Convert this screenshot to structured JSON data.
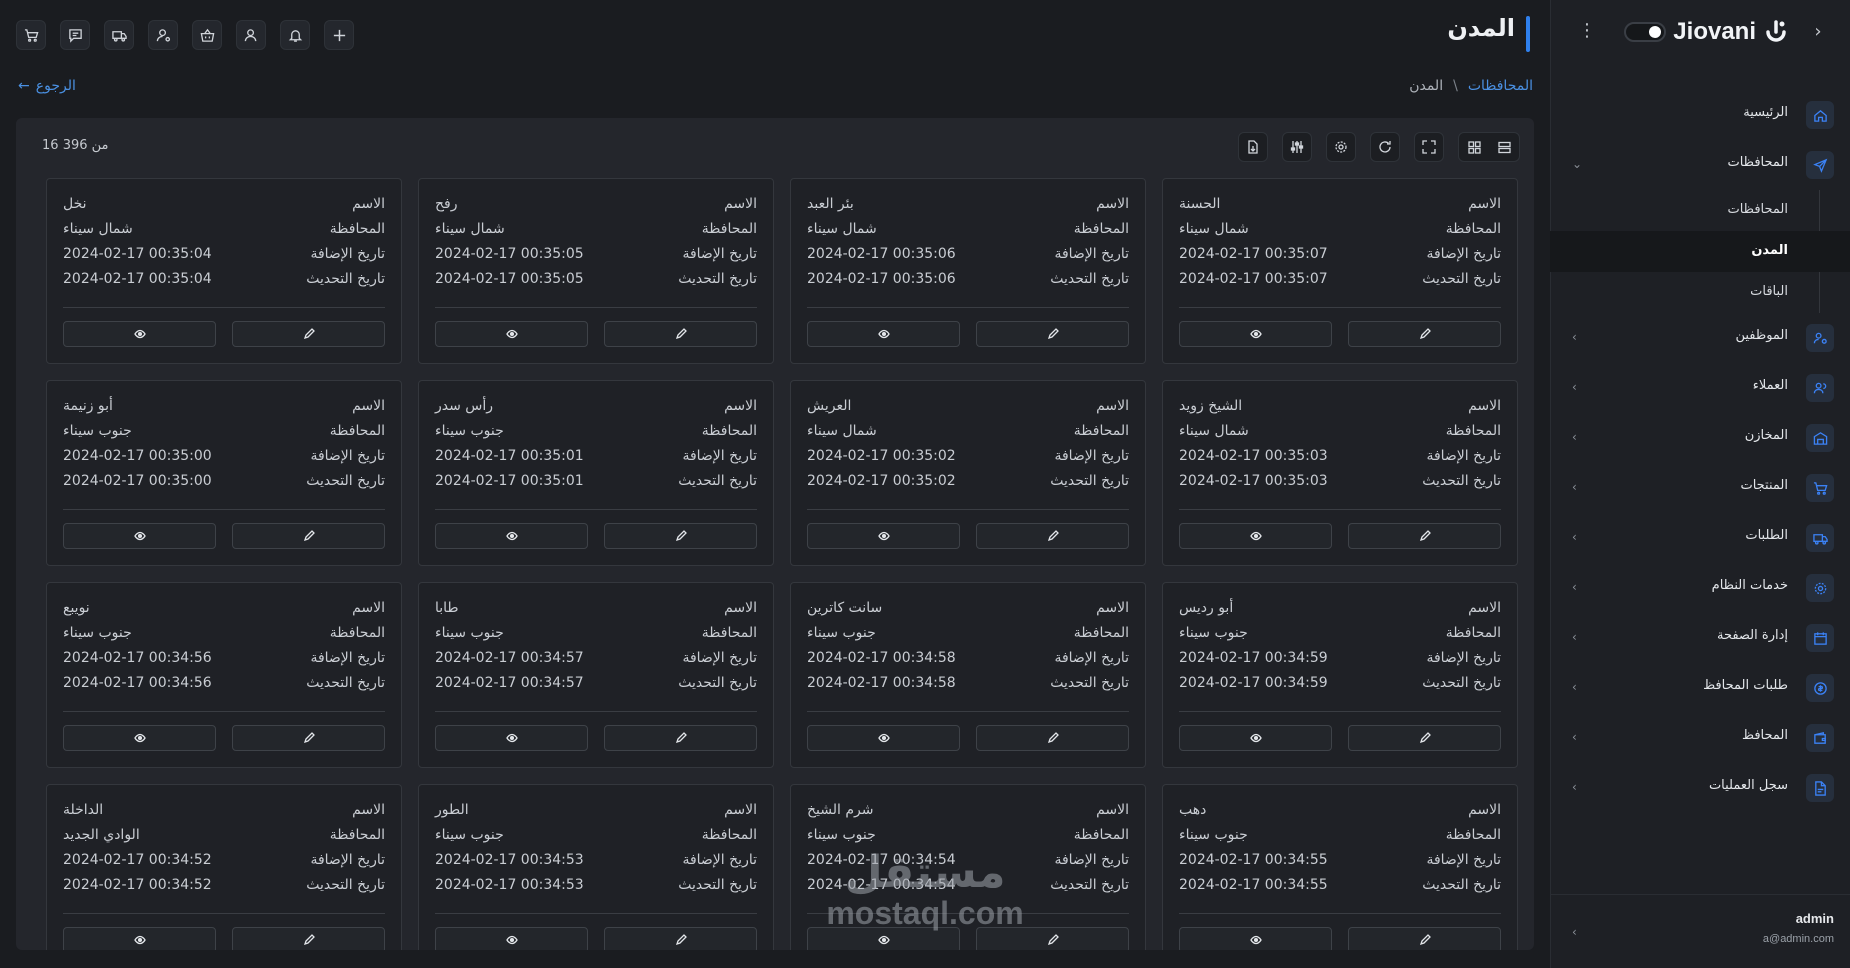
{
  "app": {
    "brand": "Jiovani"
  },
  "header": {
    "title": "المدن"
  },
  "breadcrumb": {
    "root": "المحافظات",
    "separator": "\\",
    "current": "المدن"
  },
  "back": {
    "label": "الرجوع"
  },
  "pager": {
    "count_text": "16 من 396"
  },
  "sidebar": {
    "items": [
      {
        "label": "الرئيسية",
        "icon": "home-icon"
      },
      {
        "label": "المحافظات",
        "icon": "send-icon",
        "expanded": true
      },
      {
        "label": "الموظفين",
        "icon": "users-cog-icon"
      },
      {
        "label": "العملاء",
        "icon": "users-icon"
      },
      {
        "label": "المخازن",
        "icon": "warehouse-icon"
      },
      {
        "label": "المنتجات",
        "icon": "cart-icon"
      },
      {
        "label": "الطلبات",
        "icon": "truck-icon"
      },
      {
        "label": "خدمات النظام",
        "icon": "gear-icon"
      },
      {
        "label": "إدارة الصفحة",
        "icon": "calendar-icon"
      },
      {
        "label": "طلبات المحافظ",
        "icon": "coin-icon"
      },
      {
        "label": "المحافظ",
        "icon": "wallet-icon"
      },
      {
        "label": "سجل العمليات",
        "icon": "file-icon"
      }
    ],
    "sub_items": [
      {
        "label": "المحافظات"
      },
      {
        "label": "المدن",
        "active": true
      },
      {
        "label": "الباقات"
      }
    ],
    "user": {
      "name": "admin",
      "email": "a@admin.com"
    }
  },
  "card_labels": {
    "name": "الاسم",
    "governorate": "المحافظة",
    "created": "تاريخ الإضافة",
    "updated": "تاريخ التحديث"
  },
  "cards": [
    {
      "name": "الحسنة",
      "governorate": "شمال سيناء",
      "created": "2024-02-17 00:35:07",
      "updated": "2024-02-17 00:35:07"
    },
    {
      "name": "بئر العبد",
      "governorate": "شمال سيناء",
      "created": "2024-02-17 00:35:06",
      "updated": "2024-02-17 00:35:06"
    },
    {
      "name": "رفح",
      "governorate": "شمال سيناء",
      "created": "2024-02-17 00:35:05",
      "updated": "2024-02-17 00:35:05"
    },
    {
      "name": "نخل",
      "governorate": "شمال سيناء",
      "created": "2024-02-17 00:35:04",
      "updated": "2024-02-17 00:35:04"
    },
    {
      "name": "الشيخ زويد",
      "governorate": "شمال سيناء",
      "created": "2024-02-17 00:35:03",
      "updated": "2024-02-17 00:35:03"
    },
    {
      "name": "العريش",
      "governorate": "شمال سيناء",
      "created": "2024-02-17 00:35:02",
      "updated": "2024-02-17 00:35:02"
    },
    {
      "name": "رأس سدر",
      "governorate": "جنوب سيناء",
      "created": "2024-02-17 00:35:01",
      "updated": "2024-02-17 00:35:01"
    },
    {
      "name": "أبو زنيمة",
      "governorate": "جنوب سيناء",
      "created": "2024-02-17 00:35:00",
      "updated": "2024-02-17 00:35:00"
    },
    {
      "name": "أبو رديس",
      "governorate": "جنوب سيناء",
      "created": "2024-02-17 00:34:59",
      "updated": "2024-02-17 00:34:59"
    },
    {
      "name": "سانت كاترين",
      "governorate": "جنوب سيناء",
      "created": "2024-02-17 00:34:58",
      "updated": "2024-02-17 00:34:58"
    },
    {
      "name": "طابا",
      "governorate": "جنوب سيناء",
      "created": "2024-02-17 00:34:57",
      "updated": "2024-02-17 00:34:57"
    },
    {
      "name": "نويبع",
      "governorate": "جنوب سيناء",
      "created": "2024-02-17 00:34:56",
      "updated": "2024-02-17 00:34:56"
    },
    {
      "name": "دهب",
      "governorate": "جنوب سيناء",
      "created": "2024-02-17 00:34:55",
      "updated": "2024-02-17 00:34:55"
    },
    {
      "name": "شرم الشيخ",
      "governorate": "جنوب سيناء",
      "created": "2024-02-17 00:34:54",
      "updated": "2024-02-17 00:34:54"
    },
    {
      "name": "الطور",
      "governorate": "جنوب سيناء",
      "created": "2024-02-17 00:34:53",
      "updated": "2024-02-17 00:34:53"
    },
    {
      "name": "الداخلة",
      "governorate": "الوادي الجديد",
      "created": "2024-02-17 00:34:52",
      "updated": "2024-02-17 00:34:52"
    }
  ],
  "watermark": {
    "arabic": "مستقل",
    "latin": "mostaql.com"
  },
  "colors": {
    "accent": "#2f80ed",
    "link": "#4a90e2",
    "background": "#1a1c20",
    "panel": "#24262c"
  }
}
